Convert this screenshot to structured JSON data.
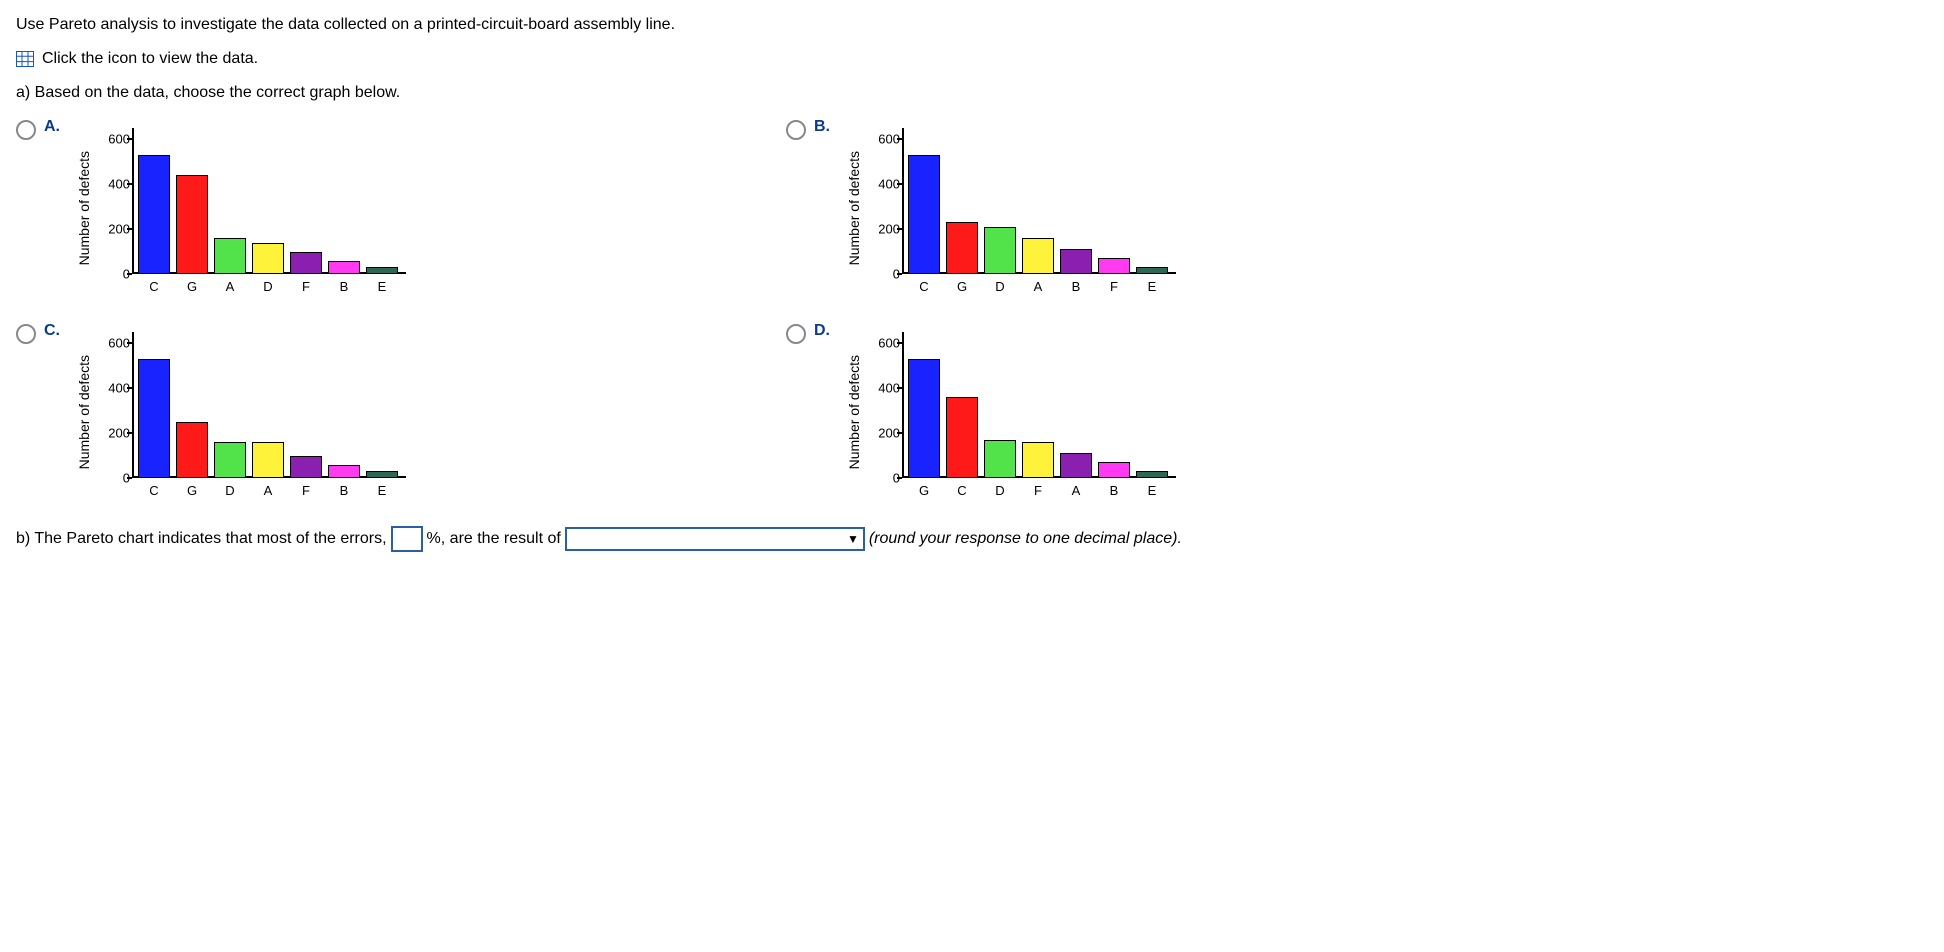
{
  "question_text": "Use Pareto analysis to investigate the data collected on a printed-circuit-board assembly line.",
  "data_link_text": "Click the icon to view the data.",
  "part_a": "a) Based on the data, choose the correct graph below.",
  "options": [
    {
      "label": "A.",
      "categories": [
        "C",
        "G",
        "A",
        "D",
        "F",
        "B",
        "E"
      ],
      "values": [
        530,
        440,
        160,
        140,
        100,
        60,
        30
      ]
    },
    {
      "label": "B.",
      "categories": [
        "C",
        "G",
        "D",
        "A",
        "B",
        "F",
        "E"
      ],
      "values": [
        530,
        230,
        210,
        160,
        110,
        70,
        30
      ]
    },
    {
      "label": "C.",
      "categories": [
        "C",
        "G",
        "D",
        "A",
        "F",
        "B",
        "E"
      ],
      "values": [
        530,
        250,
        160,
        160,
        100,
        60,
        30
      ]
    },
    {
      "label": "D.",
      "categories": [
        "G",
        "C",
        "D",
        "F",
        "A",
        "B",
        "E"
      ],
      "values": [
        530,
        360,
        170,
        160,
        110,
        70,
        30
      ]
    }
  ],
  "chart_meta": {
    "ylabel": "Number of defects",
    "yticks": [
      0,
      200,
      400,
      600
    ],
    "ymax": 650,
    "colors": [
      "#1923ff",
      "#ff1a1a",
      "#52e24a",
      "#fff23a",
      "#8a1fb0",
      "#ff3af0",
      "#2a6a55"
    ]
  },
  "part_b_pre": "b) The Pareto chart indicates that most of the errors,",
  "part_b_pct": "%, are the result of",
  "part_b_post": "(round your response to one decimal place).",
  "chart_data": [
    {
      "type": "bar",
      "title": "A",
      "ylabel": "Number of defects",
      "xlabel": "",
      "ylim": [
        0,
        600
      ],
      "categories": [
        "C",
        "G",
        "A",
        "D",
        "F",
        "B",
        "E"
      ],
      "values": [
        530,
        440,
        160,
        140,
        100,
        60,
        30
      ]
    },
    {
      "type": "bar",
      "title": "B",
      "ylabel": "Number of defects",
      "xlabel": "",
      "ylim": [
        0,
        600
      ],
      "categories": [
        "C",
        "G",
        "D",
        "A",
        "B",
        "F",
        "E"
      ],
      "values": [
        530,
        230,
        210,
        160,
        110,
        70,
        30
      ]
    },
    {
      "type": "bar",
      "title": "C",
      "ylabel": "Number of defects",
      "xlabel": "",
      "ylim": [
        0,
        600
      ],
      "categories": [
        "C",
        "G",
        "D",
        "A",
        "F",
        "B",
        "E"
      ],
      "values": [
        530,
        250,
        160,
        160,
        100,
        60,
        30
      ]
    },
    {
      "type": "bar",
      "title": "D",
      "ylabel": "Number of defects",
      "xlabel": "",
      "ylim": [
        0,
        600
      ],
      "categories": [
        "G",
        "C",
        "D",
        "F",
        "A",
        "B",
        "E"
      ],
      "values": [
        530,
        360,
        170,
        160,
        110,
        70,
        30
      ]
    }
  ]
}
